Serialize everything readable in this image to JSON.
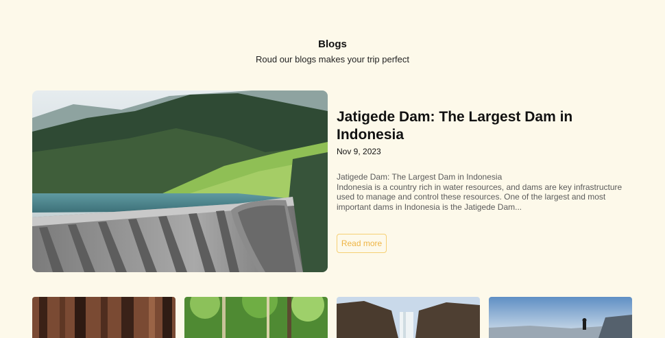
{
  "section": {
    "title": "Blogs",
    "subtitle": "Roud our blogs makes your trip perfect"
  },
  "featured_post": {
    "title": "Jatigede Dam: The Largest Dam in Indonesia",
    "date": "Nov 9, 2023",
    "excerpt_heading": "Jatigede Dam: The Largest Dam in Indonesia",
    "excerpt_body": "Indonesia is a country rich in water resources, and dams are key infrastructure used to manage and control these resources. One of the largest and most important dams in Indonesia is the Jatigede Dam...",
    "read_more_label": "Read more"
  },
  "cards": [
    {
      "image": "forest-trees"
    },
    {
      "image": "green-jungle"
    },
    {
      "image": "waterfall-cliffs"
    },
    {
      "image": "mountain-hiker"
    }
  ],
  "colors": {
    "background": "#fdf9ea",
    "accent": "#eeb443",
    "accent_border": "#f6cf72"
  }
}
